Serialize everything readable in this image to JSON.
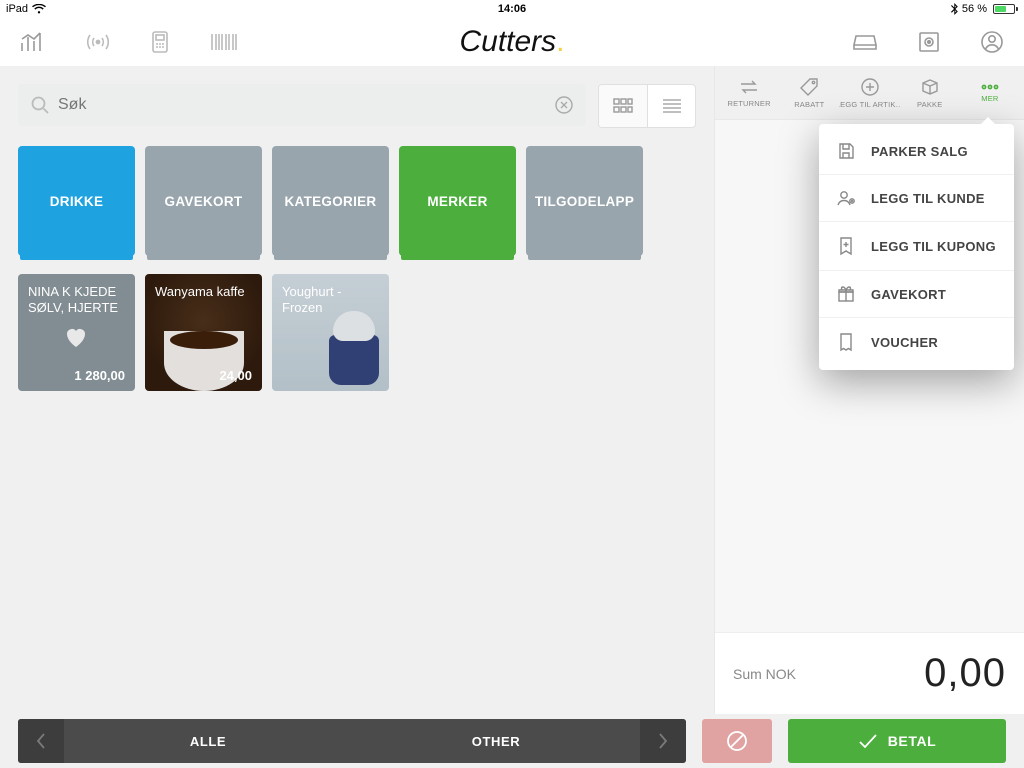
{
  "status": {
    "device": "iPad",
    "time": "14:06",
    "battery_pct": "56 %"
  },
  "brand": "Cutters",
  "search": {
    "placeholder": "Søk"
  },
  "categories": [
    {
      "label": "DRIKKE",
      "style": "cat-blue"
    },
    {
      "label": "GAVEKORT",
      "style": "cat-gray"
    },
    {
      "label": "KATEGORIER",
      "style": "cat-gray"
    },
    {
      "label": "MERKER",
      "style": "cat-green"
    },
    {
      "label": "TILGODELAPP",
      "style": "cat-gray"
    }
  ],
  "products": [
    {
      "name": "NINA K KJEDE SØLV, HJERTE",
      "price": "1 280,00"
    },
    {
      "name": "Wanyama kaffe",
      "price": "24,00"
    },
    {
      "name": "Youghurt - Frozen",
      "price": ""
    }
  ],
  "rt_toolbar": [
    {
      "label": "RETURNER"
    },
    {
      "label": "RABATT"
    },
    {
      "label": "LEGG TIL ARTIK…"
    },
    {
      "label": "PAKKE"
    },
    {
      "label": "MER"
    }
  ],
  "more_menu": [
    {
      "label": "PARKER SALG"
    },
    {
      "label": "LEGG TIL KUNDE"
    },
    {
      "label": "LEGG TIL KUPONG"
    },
    {
      "label": "GAVEKORT"
    },
    {
      "label": "VOUCHER"
    }
  ],
  "sum": {
    "label": "Sum NOK",
    "value": "0,00"
  },
  "bottom": {
    "seg1": "ALLE",
    "seg2": "OTHER",
    "pay": "BETAL"
  }
}
